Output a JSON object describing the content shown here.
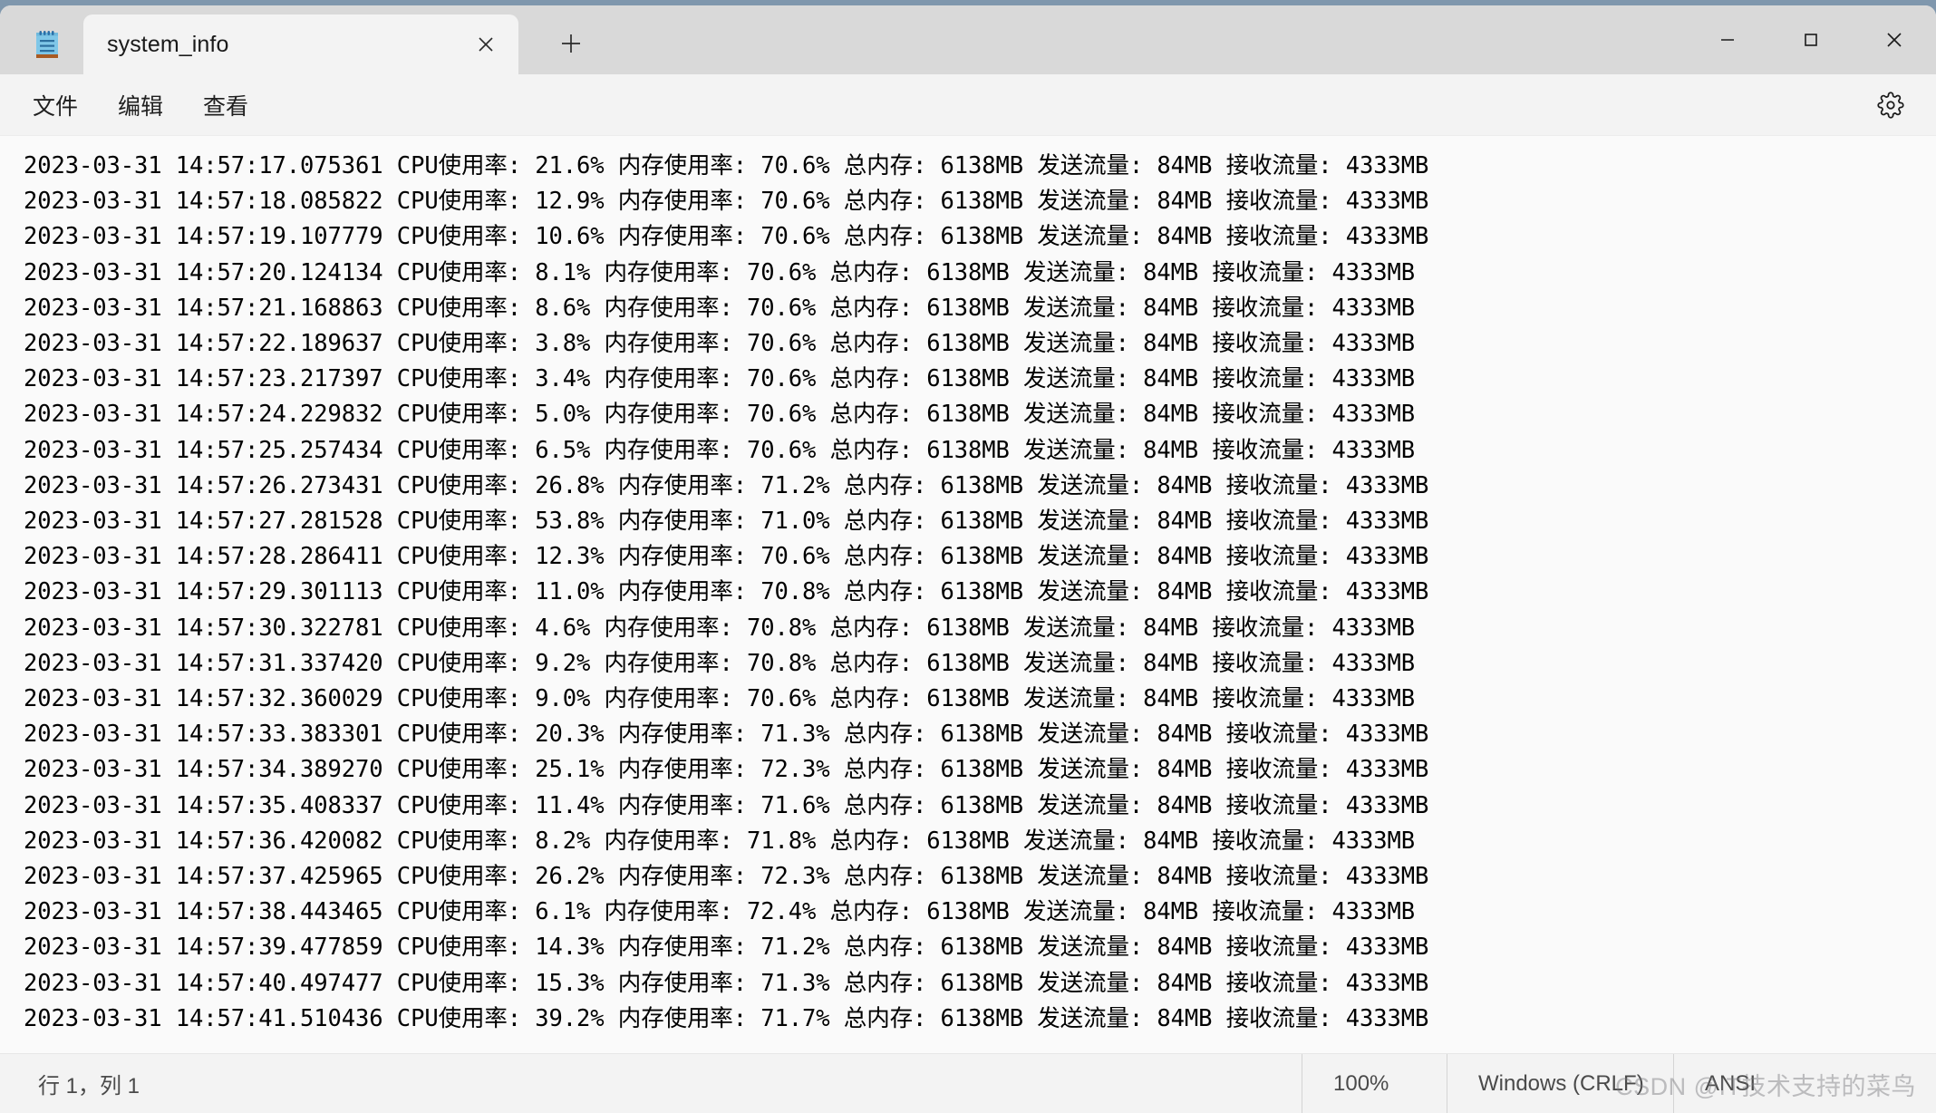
{
  "window": {
    "app_icon": "notepad-icon",
    "controls": {
      "minimize": "minimize-icon",
      "maximize": "maximize-icon",
      "close": "close-icon"
    }
  },
  "tabbar": {
    "tabs": [
      {
        "title": "system_info",
        "close_icon": "close-icon",
        "active": true
      }
    ],
    "new_tab_icon": "plus-icon"
  },
  "menubar": {
    "items": [
      {
        "label": "文件"
      },
      {
        "label": "编辑"
      },
      {
        "label": "查看"
      }
    ],
    "settings_icon": "gear-icon"
  },
  "editor": {
    "lines": [
      "2023-03-31 14:57:17.075361 CPU使用率: 21.6% 内存使用率: 70.6% 总内存: 6138MB 发送流量: 84MB 接收流量: 4333MB",
      "2023-03-31 14:57:18.085822 CPU使用率: 12.9% 内存使用率: 70.6% 总内存: 6138MB 发送流量: 84MB 接收流量: 4333MB",
      "2023-03-31 14:57:19.107779 CPU使用率: 10.6% 内存使用率: 70.6% 总内存: 6138MB 发送流量: 84MB 接收流量: 4333MB",
      "2023-03-31 14:57:20.124134 CPU使用率: 8.1% 内存使用率: 70.6% 总内存: 6138MB 发送流量: 84MB 接收流量: 4333MB",
      "2023-03-31 14:57:21.168863 CPU使用率: 8.6% 内存使用率: 70.6% 总内存: 6138MB 发送流量: 84MB 接收流量: 4333MB",
      "2023-03-31 14:57:22.189637 CPU使用率: 3.8% 内存使用率: 70.6% 总内存: 6138MB 发送流量: 84MB 接收流量: 4333MB",
      "2023-03-31 14:57:23.217397 CPU使用率: 3.4% 内存使用率: 70.6% 总内存: 6138MB 发送流量: 84MB 接收流量: 4333MB",
      "2023-03-31 14:57:24.229832 CPU使用率: 5.0% 内存使用率: 70.6% 总内存: 6138MB 发送流量: 84MB 接收流量: 4333MB",
      "2023-03-31 14:57:25.257434 CPU使用率: 6.5% 内存使用率: 70.6% 总内存: 6138MB 发送流量: 84MB 接收流量: 4333MB",
      "2023-03-31 14:57:26.273431 CPU使用率: 26.8% 内存使用率: 71.2% 总内存: 6138MB 发送流量: 84MB 接收流量: 4333MB",
      "2023-03-31 14:57:27.281528 CPU使用率: 53.8% 内存使用率: 71.0% 总内存: 6138MB 发送流量: 84MB 接收流量: 4333MB",
      "2023-03-31 14:57:28.286411 CPU使用率: 12.3% 内存使用率: 70.6% 总内存: 6138MB 发送流量: 84MB 接收流量: 4333MB",
      "2023-03-31 14:57:29.301113 CPU使用率: 11.0% 内存使用率: 70.8% 总内存: 6138MB 发送流量: 84MB 接收流量: 4333MB",
      "2023-03-31 14:57:30.322781 CPU使用率: 4.6% 内存使用率: 70.8% 总内存: 6138MB 发送流量: 84MB 接收流量: 4333MB",
      "2023-03-31 14:57:31.337420 CPU使用率: 9.2% 内存使用率: 70.8% 总内存: 6138MB 发送流量: 84MB 接收流量: 4333MB",
      "2023-03-31 14:57:32.360029 CPU使用率: 9.0% 内存使用率: 70.6% 总内存: 6138MB 发送流量: 84MB 接收流量: 4333MB",
      "2023-03-31 14:57:33.383301 CPU使用率: 20.3% 内存使用率: 71.3% 总内存: 6138MB 发送流量: 84MB 接收流量: 4333MB",
      "2023-03-31 14:57:34.389270 CPU使用率: 25.1% 内存使用率: 72.3% 总内存: 6138MB 发送流量: 84MB 接收流量: 4333MB",
      "2023-03-31 14:57:35.408337 CPU使用率: 11.4% 内存使用率: 71.6% 总内存: 6138MB 发送流量: 84MB 接收流量: 4333MB",
      "2023-03-31 14:57:36.420082 CPU使用率: 8.2% 内存使用率: 71.8% 总内存: 6138MB 发送流量: 84MB 接收流量: 4333MB",
      "2023-03-31 14:57:37.425965 CPU使用率: 26.2% 内存使用率: 72.3% 总内存: 6138MB 发送流量: 84MB 接收流量: 4333MB",
      "2023-03-31 14:57:38.443465 CPU使用率: 6.1% 内存使用率: 72.4% 总内存: 6138MB 发送流量: 84MB 接收流量: 4333MB",
      "2023-03-31 14:57:39.477859 CPU使用率: 14.3% 内存使用率: 71.2% 总内存: 6138MB 发送流量: 84MB 接收流量: 4333MB",
      "2023-03-31 14:57:40.497477 CPU使用率: 15.3% 内存使用率: 71.3% 总内存: 6138MB 发送流量: 84MB 接收流量: 4333MB",
      "2023-03-31 14:57:41.510436 CPU使用率: 39.2% 内存使用率: 71.7% 总内存: 6138MB 发送流量: 84MB 接收流量: 4333MB"
    ]
  },
  "statusbar": {
    "cursor_position": "行 1，列 1",
    "zoom": "100%",
    "line_ending": "Windows (CRLF)",
    "encoding": "ANSI"
  },
  "watermark": {
    "text": "CSDN @IT技术支持的菜鸟"
  }
}
